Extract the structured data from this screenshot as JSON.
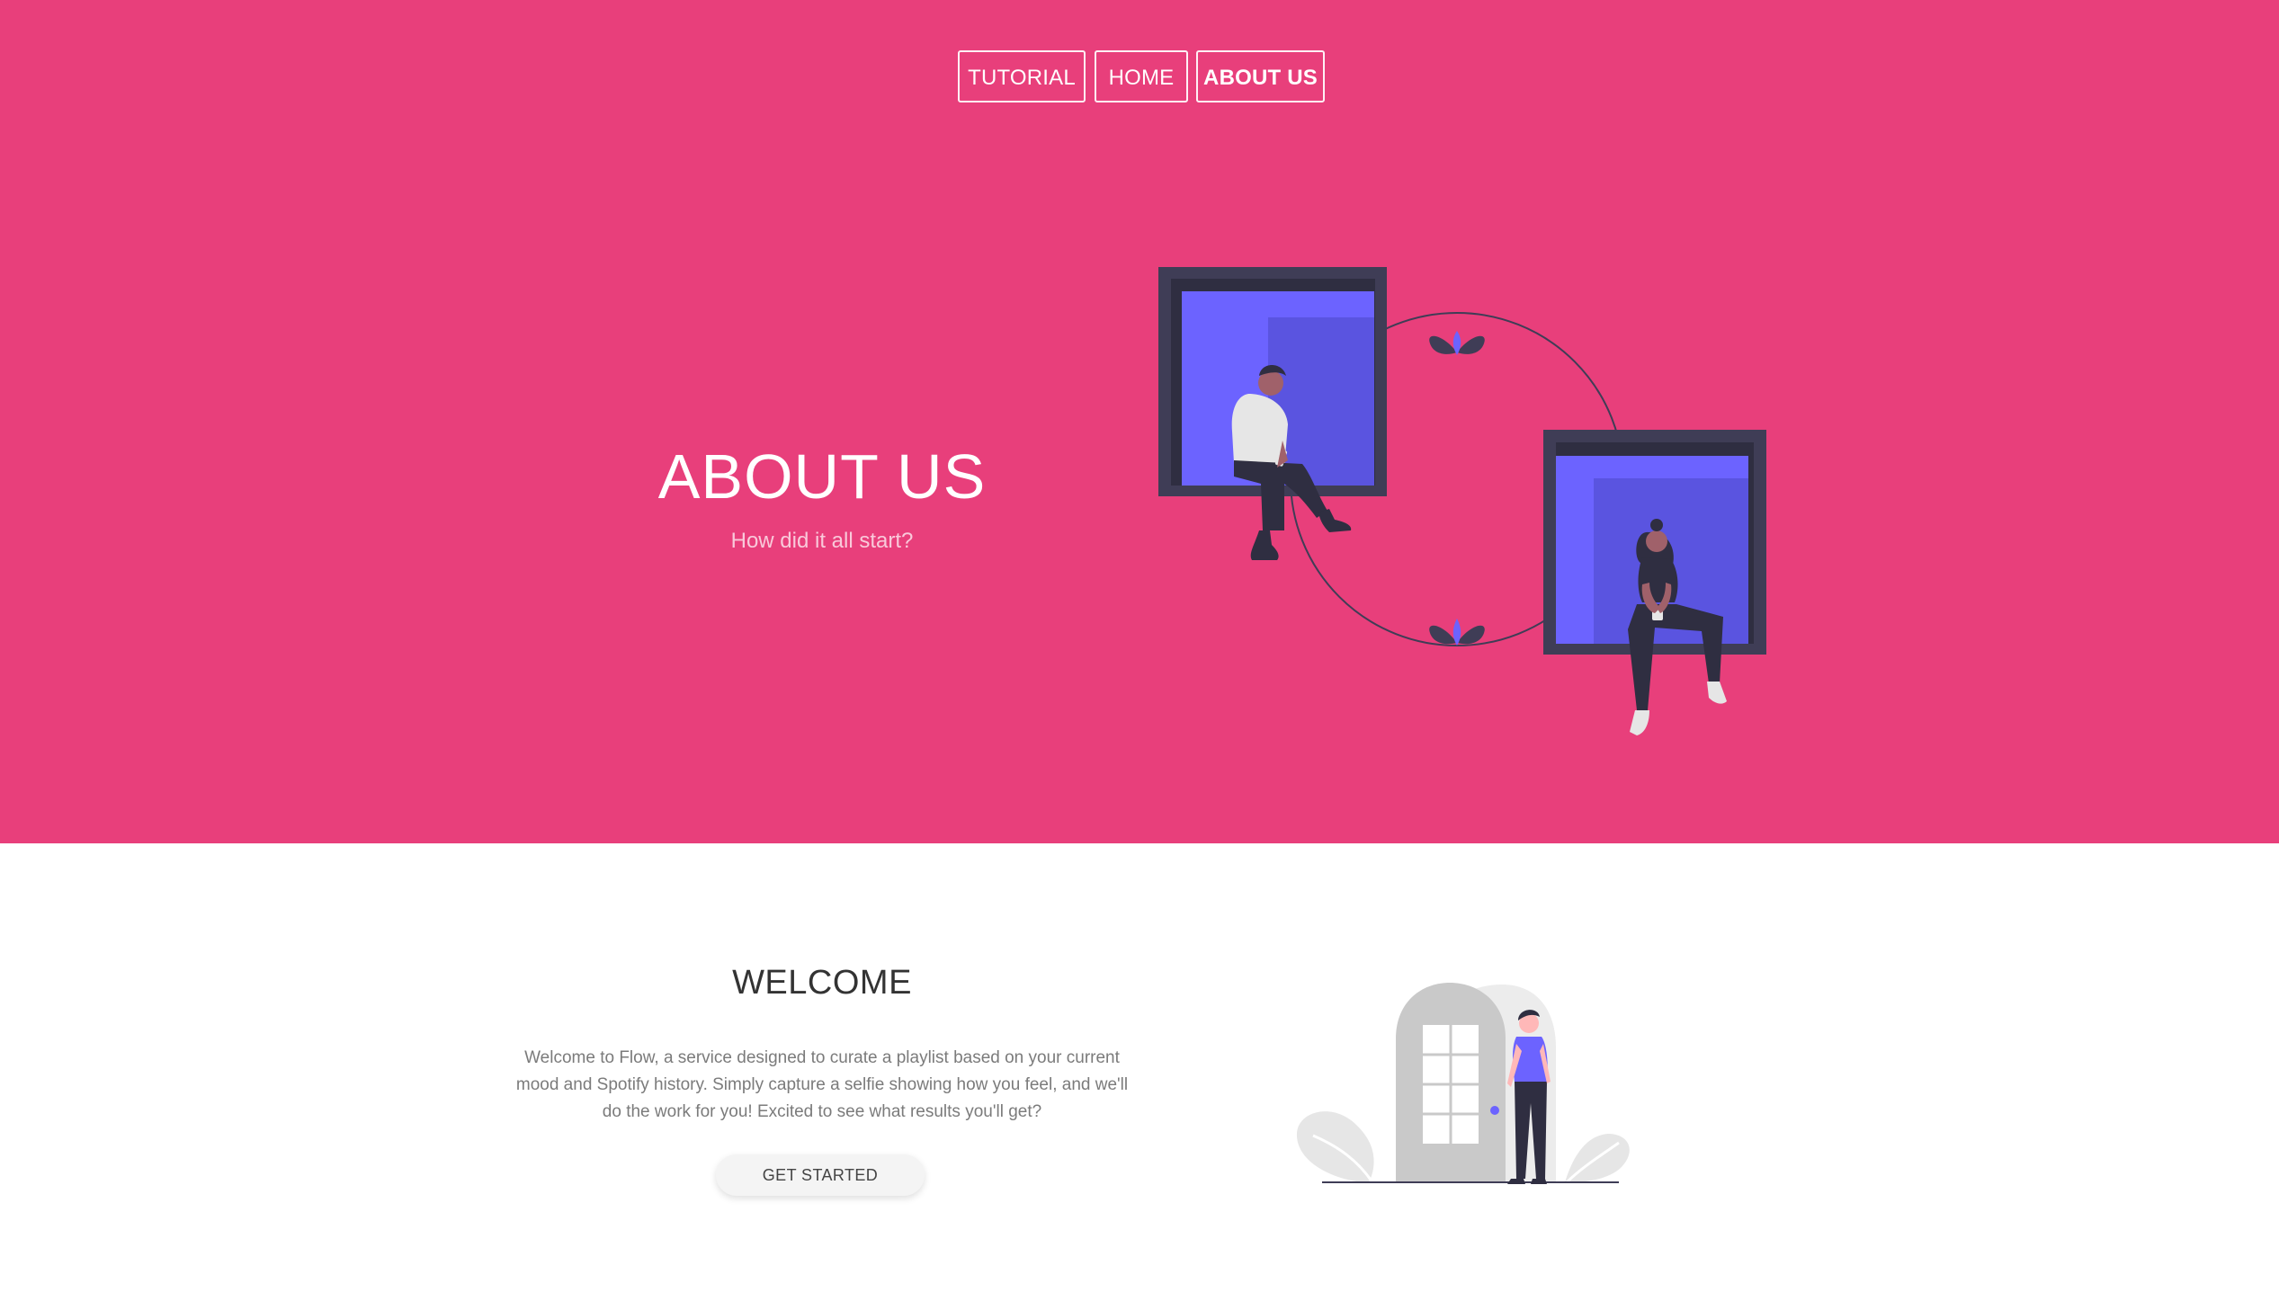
{
  "nav": {
    "items": [
      {
        "label": "TUTORIAL",
        "active": false
      },
      {
        "label": "HOME",
        "active": false
      },
      {
        "label": "ABOUT US",
        "active": true
      }
    ]
  },
  "hero": {
    "title": "ABOUT US",
    "subtitle": "How did it all start?",
    "illustration": "two-people-sitting-in-windows-illustration"
  },
  "welcome": {
    "title": "WELCOME",
    "text": "Welcome to Flow, a service designed to curate a playlist based on your current mood and Spotify history. Simply capture a selfie showing how you feel, and we'll do the work for you! Excited to see what results you'll get?",
    "button_label": "GET STARTED",
    "illustration": "person-at-door-illustration"
  },
  "colors": {
    "hero_bg": "#e83f7b",
    "accent": "#6c63ff",
    "dark": "#3f3d56",
    "page_bg": "#ffffff"
  }
}
